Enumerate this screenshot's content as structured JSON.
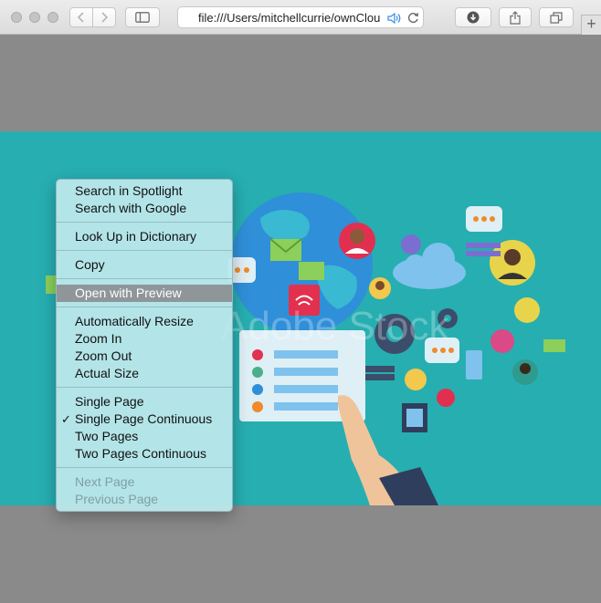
{
  "browser": {
    "url": "file:///Users/mitchellcurrie/ownCloud",
    "tab_add_label": "+"
  },
  "image": {
    "watermark": "Adobe Stock"
  },
  "context_menu": {
    "search_spotlight": "Search in Spotlight",
    "search_google": "Search with Google",
    "look_up": "Look Up in Dictionary",
    "copy": "Copy",
    "open_preview": "Open with Preview",
    "auto_resize": "Automatically Resize",
    "zoom_in": "Zoom In",
    "zoom_out": "Zoom Out",
    "actual_size": "Actual Size",
    "single_page": "Single Page",
    "single_page_continuous": "Single Page Continuous",
    "checkmark": "✓",
    "two_pages": "Two Pages",
    "two_pages_continuous": "Two Pages Continuous",
    "next_page": "Next Page",
    "previous_page": "Previous Page"
  },
  "colors": {
    "image_bg": "#27aeb1",
    "menu_bg": "#bee8ec",
    "highlight": "#8f969a"
  }
}
